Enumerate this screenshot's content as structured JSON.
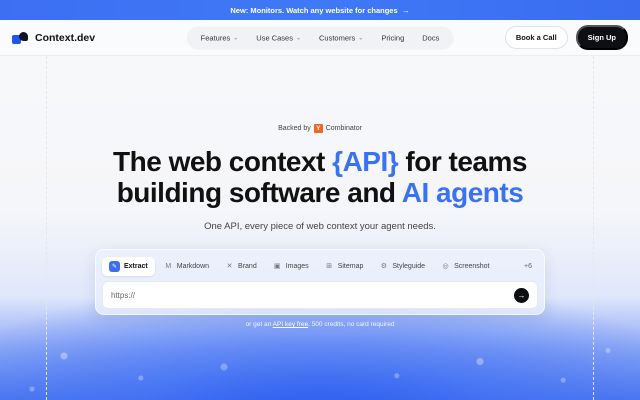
{
  "banner": {
    "text": "New: Monitors. Watch any website for changes",
    "arrow": "→"
  },
  "brand": {
    "name": "Context.dev"
  },
  "nav": {
    "items": [
      {
        "label": "Features",
        "dropdown": true
      },
      {
        "label": "Use Cases",
        "dropdown": true
      },
      {
        "label": "Customers",
        "dropdown": true
      },
      {
        "label": "Pricing",
        "dropdown": false
      },
      {
        "label": "Docs",
        "dropdown": false
      }
    ],
    "book_call": "Book a Call",
    "sign_up": "Sign Up"
  },
  "hero": {
    "backed_prefix": "Backed by",
    "yc_letter": "Y",
    "backed_suffix": "Combinator",
    "headline": {
      "part1": "The web context ",
      "highlight1": "{API}",
      "part2": " for teams",
      "part3": "building software and ",
      "highlight2": "AI agents"
    },
    "subtitle": "One API, every piece of web context your agent needs."
  },
  "tool": {
    "tabs": [
      {
        "label": "Extract",
        "icon": "✎"
      },
      {
        "label": "Markdown",
        "icon": "M"
      },
      {
        "label": "Brand",
        "icon": "✕"
      },
      {
        "label": "Images",
        "icon": "▣"
      },
      {
        "label": "Sitemap",
        "icon": "⊞"
      },
      {
        "label": "Styleguide",
        "icon": "⚙"
      },
      {
        "label": "Screenshot",
        "icon": "◎"
      }
    ],
    "more_label": "+6",
    "url_placeholder": "https://",
    "go_arrow": "→"
  },
  "cta": {
    "prefix": "or get an ",
    "link": "API key free",
    "suffix": ". 500 credits, no card required"
  },
  "colors": {
    "accent": "#3b72f0",
    "banner": "#3d6ff2",
    "dark_button": "#0e0f12",
    "yc_orange": "#f26522"
  }
}
